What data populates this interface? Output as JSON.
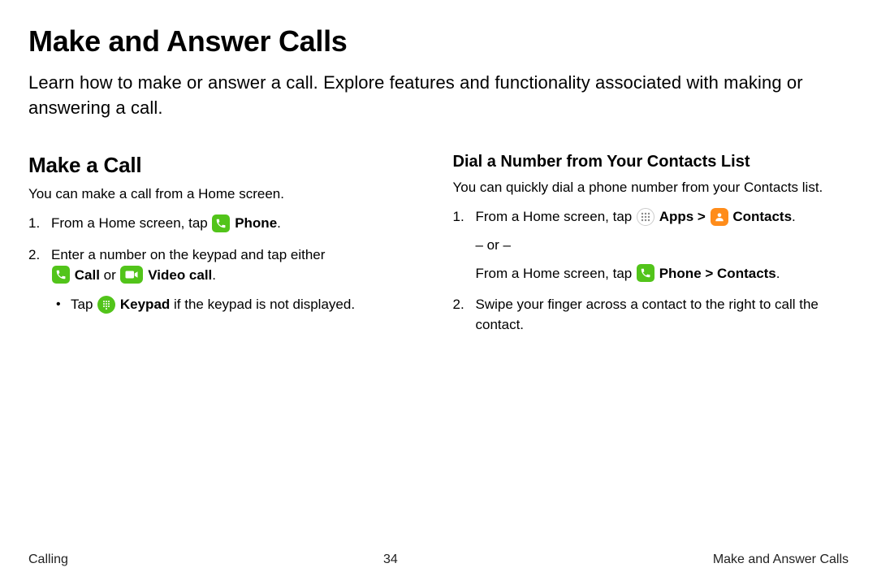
{
  "title": "Make and Answer Calls",
  "intro": "Learn how to make or answer a call. Explore features and functionality associated with making or answering a call.",
  "left": {
    "heading": "Make a Call",
    "desc": "You can make a call from a Home screen.",
    "step1_pre": "From a Home screen, tap ",
    "step1_label": "Phone",
    "step1_post": ".",
    "step2_pre": "Enter a number on the keypad and tap either ",
    "step2_call": "Call",
    "step2_or": " or ",
    "step2_video": "Video call",
    "step2_post": ".",
    "bullet_pre": "Tap ",
    "bullet_label": "Keypad",
    "bullet_post": " if the keypad is not displayed."
  },
  "right": {
    "heading": "Dial a Number from Your Contacts List",
    "desc": "You can quickly dial a phone number from your Contacts list.",
    "step1_pre": "From a Home screen, tap ",
    "step1_apps": "Apps",
    "step1_chev": " > ",
    "step1_contacts": "Contacts",
    "step1_post": ".",
    "or_text": "– or –",
    "alt_pre": "From a Home screen, tap ",
    "alt_phone": "Phone",
    "alt_chev": " > ",
    "alt_contacts": "Contacts",
    "alt_post": ".",
    "step2": "Swipe your finger across a contact to the right to call the contact."
  },
  "footer": {
    "left": "Calling",
    "center": "34",
    "right": "Make and Answer Calls"
  }
}
